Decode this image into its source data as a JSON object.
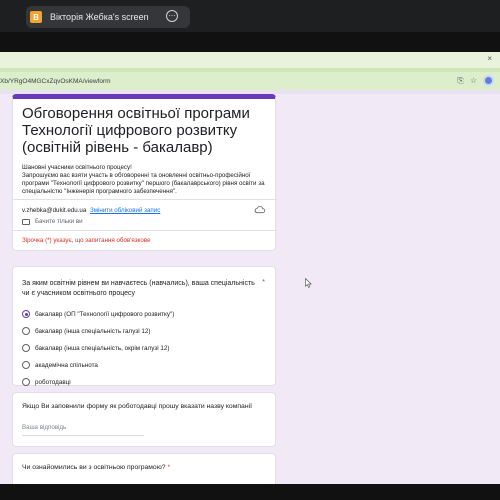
{
  "meeting": {
    "share_badge": "В",
    "share_title": "Вікторія Жебка's screen",
    "more_glyph": "⋯"
  },
  "browser": {
    "url": "Xb/YRgO4MGCxZqvOsKMA/viewform",
    "profile_color": "#5f7fd8",
    "accent_strip": "#dceecc",
    "icons": [
      "translate-icon",
      "extension-icon",
      "profile-avatar"
    ]
  },
  "form": {
    "accent": "#673ab7",
    "title": "Обговорення освітньої програми Технології цифрового розвитку  (освітній рівень - бакалавр)",
    "description": "Шановні учасники освітнього процесу!\nЗапрошуємо вас взяти участь в обговоренні та оновленні освітньо-професійної програми \"Технології цифрового розвитку\" першого (бакалаврського) рівня освіти за спеціальністю \"Інженерія програмного забезпечення\".",
    "account_email": "v.zhebka@dukit.edu.ua",
    "switch_account": "Змінити обліковий запис",
    "not_shared": "Бачите тільки ви",
    "required_note": "Зірочка (*) указує, що запитання обов'язкове",
    "question1": {
      "text": "За яким освітнім рівнем ви навчаєтесь (навчались), ваша спеціальність чи є учасником освітнього процесу",
      "required_mark": "*",
      "options": [
        "бакалавр (ОП \"Технології цифрового розвитку\")",
        "бакалавр (інша спеціальність галузі 12)",
        "бакалавр (інша спеціальність, окрім галузі 12)",
        "академічна спільнота",
        "роботодавці"
      ],
      "selected_index": 0
    },
    "question2": {
      "text": "Якщо Ви заповнили форму як роботодавці прошу вказати назву компанії",
      "placeholder": "Ваша відповідь"
    },
    "question3": {
      "text": "Чи ознайомились ви з освітньою програмою?",
      "required_mark": "*"
    }
  }
}
